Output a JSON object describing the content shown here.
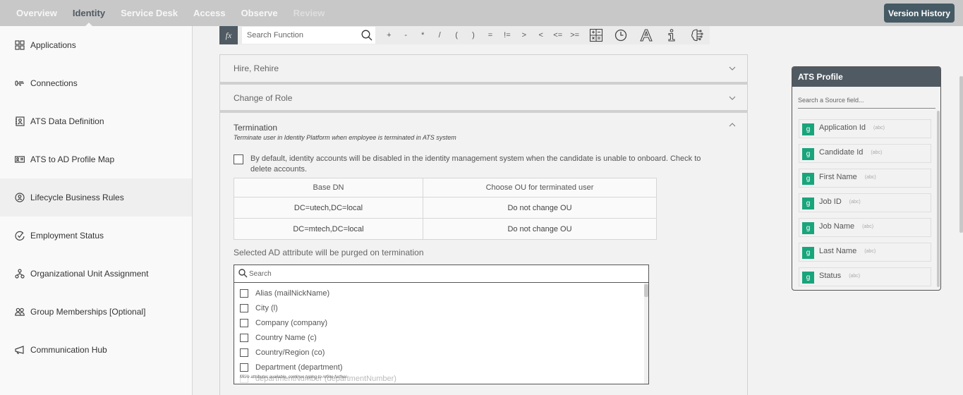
{
  "topnav": {
    "tabs": [
      {
        "label": "Overview",
        "state": "normal"
      },
      {
        "label": "Identity",
        "state": "active"
      },
      {
        "label": "Service Desk",
        "state": "normal"
      },
      {
        "label": "Access",
        "state": "normal"
      },
      {
        "label": "Observe",
        "state": "normal"
      },
      {
        "label": "Review",
        "state": "disabled"
      }
    ],
    "version_history_label": "Version History"
  },
  "sidebar": {
    "items": [
      {
        "label": "Applications",
        "icon": "grid-icon"
      },
      {
        "label": "Connections",
        "icon": "connection-icon"
      },
      {
        "label": "ATS Data Definition",
        "icon": "contact-card-icon"
      },
      {
        "label": "ATS to AD Profile Map",
        "icon": "id-card-icon"
      },
      {
        "label": "Lifecycle Business Rules",
        "icon": "user-circle-icon",
        "active": true
      },
      {
        "label": "Employment Status",
        "icon": "check-circle-icon"
      },
      {
        "label": "Organizational Unit Assignment",
        "icon": "org-chart-icon"
      },
      {
        "label": "Group Memberships [Optional]",
        "icon": "group-icon"
      },
      {
        "label": "Communication Hub",
        "icon": "megaphone-icon"
      }
    ]
  },
  "function_bar": {
    "fx_label": "fx",
    "search_placeholder": "Search Function",
    "operators": [
      "+",
      "-",
      "*",
      "/",
      "(",
      ")",
      "=",
      "!=",
      ">",
      "<",
      "<=",
      ">="
    ],
    "tools": [
      "calculator-icon",
      "clock-icon",
      "text-format-icon",
      "info-icon",
      "brain-icon"
    ]
  },
  "accordion": {
    "sections": [
      {
        "title": "Hire, Rehire",
        "expanded": false
      },
      {
        "title": "Change of Role",
        "expanded": false
      },
      {
        "title": "Termination",
        "expanded": true,
        "subtitle": "Terminate user in Identity Platform when employee is terminated in ATS system"
      }
    ]
  },
  "termination": {
    "delete_accounts_checked": false,
    "delete_accounts_text": "By default, identity accounts will be disabled in the identity management system when the candidate is unable to onboard. Check to delete accounts.",
    "ou_table": {
      "headers": [
        "Base DN",
        "Choose OU for terminated user"
      ],
      "rows": [
        [
          "DC=utech,DC=local",
          "Do not change OU"
        ],
        [
          "DC=mtech,DC=local",
          "Do not change OU"
        ]
      ]
    },
    "purge_label": "Selected AD attribute will be purged on termination",
    "attribute_search_placeholder": "Search",
    "attributes": [
      {
        "label": "Alias (mailNickName)",
        "checked": false
      },
      {
        "label": "City (l)",
        "checked": false
      },
      {
        "label": "Company (company)",
        "checked": false
      },
      {
        "label": "Country Name (c)",
        "checked": false
      },
      {
        "label": "Country/Region (co)",
        "checked": false
      },
      {
        "label": "Department (department)",
        "checked": false
      }
    ],
    "partial_attribute": "departmentNumber (departmentNumber)",
    "more_hint": "More attributes available, continue typing to refine further."
  },
  "ats_profile": {
    "title": "ATS Profile",
    "search_placeholder": "Search a Source field...",
    "fields": [
      {
        "name": "Application Id",
        "type": "(abc)"
      },
      {
        "name": "Candidate Id",
        "type": "(abc)"
      },
      {
        "name": "First Name",
        "type": "(abc)"
      },
      {
        "name": "Job ID",
        "type": "(abc)"
      },
      {
        "name": "Job Name",
        "type": "(abc)"
      },
      {
        "name": "Last Name",
        "type": "(abc)"
      },
      {
        "name": "Status",
        "type": "(abc)"
      }
    ],
    "field_icon_glyph": "g"
  }
}
